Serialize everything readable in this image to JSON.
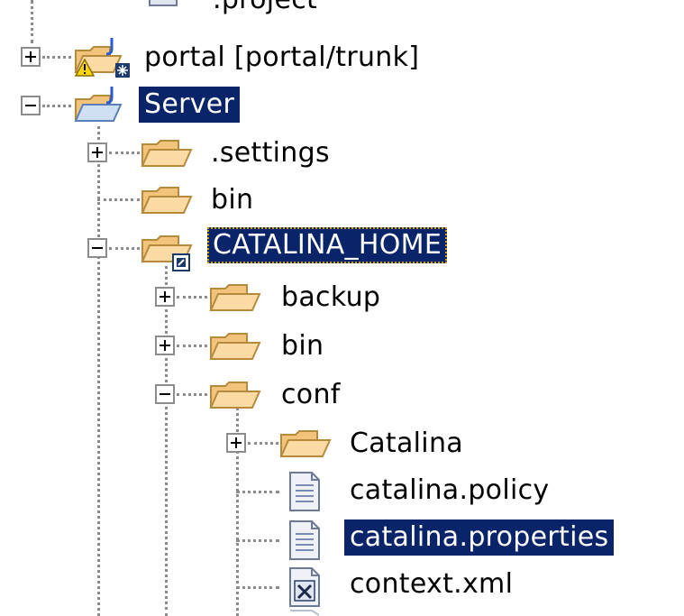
{
  "tree": {
    "partial_top_label": ".project",
    "items": [
      {
        "label": "portal [portal/trunk]"
      },
      {
        "label": "Server"
      },
      {
        "label": ".settings"
      },
      {
        "label": "bin"
      },
      {
        "label": "CATALINA_HOME"
      },
      {
        "label": "backup"
      },
      {
        "label": "bin"
      },
      {
        "label": "conf"
      },
      {
        "label": "Catalina"
      },
      {
        "label": "catalina.policy"
      },
      {
        "label": "catalina.properties"
      },
      {
        "label": "context.xml"
      }
    ]
  },
  "colors": {
    "selection_bg": "#0a246a",
    "selection_fg": "#ffffff",
    "folder": "#f2c37a",
    "guide": "#8c8c8c"
  }
}
